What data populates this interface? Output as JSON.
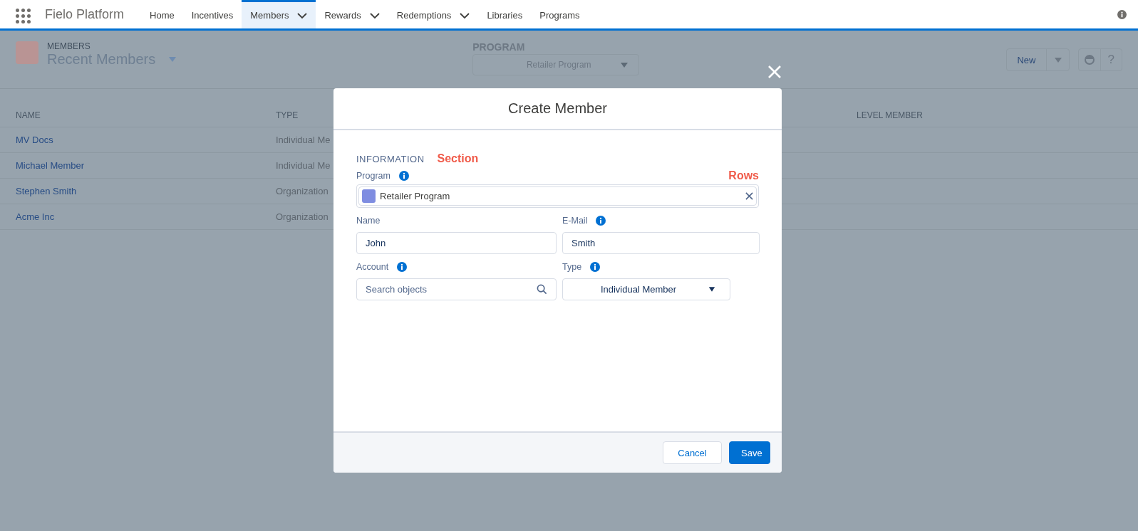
{
  "app": {
    "name": "Fielo Platform"
  },
  "nav_tabs": [
    {
      "label": "Home",
      "selected": false,
      "has_menu": false
    },
    {
      "label": "Incentives",
      "selected": false,
      "has_menu": false
    },
    {
      "label": "Members",
      "selected": true,
      "has_menu": true
    },
    {
      "label": "Rewards",
      "selected": false,
      "has_menu": true
    },
    {
      "label": "Redemptions",
      "selected": false,
      "has_menu": true
    },
    {
      "label": "Libraries",
      "selected": false,
      "has_menu": false
    },
    {
      "label": "Programs",
      "selected": false,
      "has_menu": false
    }
  ],
  "header": {
    "object": "MEMBERS",
    "view": "Recent Members",
    "program_label": "PROGRAM",
    "program_value": "Retailer Program",
    "new_button": "New",
    "help": "?"
  },
  "table": {
    "columns": [
      "NAME",
      "TYPE",
      "LEVEL MEMBER"
    ],
    "rows": [
      {
        "name": "MV Docs",
        "type": "Individual Me"
      },
      {
        "name": "Michael Member",
        "type": "Individual Me"
      },
      {
        "name": "Stephen Smith",
        "type": "Organization"
      },
      {
        "name": "Acme Inc",
        "type": "Organization"
      }
    ]
  },
  "modal": {
    "title": "Create Member",
    "section": "INFORMATION",
    "annotations": [
      "Section",
      "Rows"
    ],
    "fields": [
      {
        "kind": "lookup",
        "label": "Program",
        "info": true,
        "value": "Retailer Program"
      },
      {
        "kind": "text",
        "label": "Name",
        "info": false,
        "value": "John"
      },
      {
        "kind": "text",
        "label": "E-Mail",
        "info": true,
        "value": "Smith"
      },
      {
        "kind": "search",
        "label": "Account",
        "info": true,
        "placeholder": "Search objects"
      },
      {
        "kind": "select",
        "label": "Type",
        "info": true,
        "value": "Individual Member"
      }
    ],
    "buttons": [
      {
        "label": "Cancel",
        "kind": "neutral"
      },
      {
        "label": "Save",
        "kind": "brand"
      }
    ]
  }
}
